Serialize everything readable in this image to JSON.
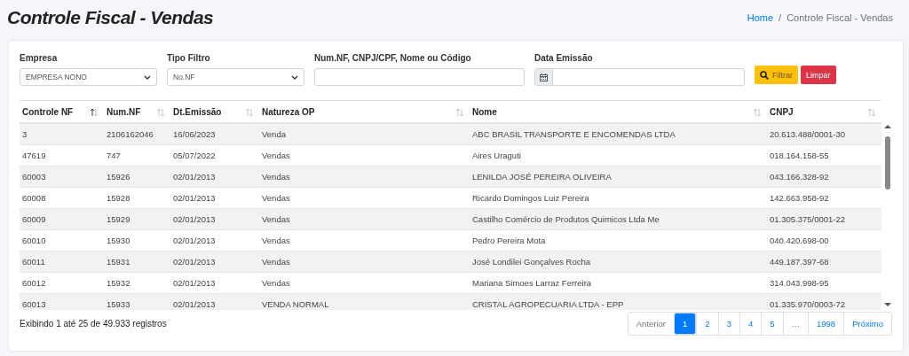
{
  "page_title": "Controle Fiscal - Vendas",
  "breadcrumb": [
    {
      "label": "Home",
      "link": true
    },
    {
      "label": "Controle Fiscal - Vendas",
      "link": false
    }
  ],
  "breadcrumb_separator": "/",
  "filters": [
    {
      "kind": "select",
      "label": "Empresa",
      "value": "EMPRESA NONO"
    },
    {
      "kind": "select",
      "label": "Tipo Filtro",
      "value": "No.NF"
    },
    {
      "kind": "text",
      "label": "Num.NF, CNPJ/CPF, Nome ou Código"
    },
    {
      "kind": "date",
      "label": "Data Emissão"
    }
  ],
  "buttons": [
    {
      "label": "Filtrar",
      "kind": "search"
    },
    {
      "label": "Limpar",
      "kind": "danger"
    }
  ],
  "table": {
    "columns": [
      {
        "label": "Controle NF",
        "sorted": true
      },
      {
        "label": "Num.NF",
        "sorted": false
      },
      {
        "label": "Dt.Emissão",
        "sorted": false
      },
      {
        "label": "Natureza OP",
        "sorted": false
      },
      {
        "label": "Nome",
        "sorted": false
      },
      {
        "label": "CNPJ",
        "sorted": false
      }
    ],
    "rows": [
      [
        "3",
        "2106162046",
        "16/06/2023",
        "Venda",
        "ABC BRASIL TRANSPORTE E ENCOMENDAS LTDA",
        "20.613.488/0001-30"
      ],
      [
        "47619",
        "747",
        "05/07/2022",
        "Vendas",
        "Aires Uraguti",
        "018.164.158-55"
      ],
      [
        "60003",
        "15926",
        "02/01/2013",
        "Vendas",
        "LENILDA JOSÉ PEREIRA OLIVEIRA",
        "043.166.328-92"
      ],
      [
        "60008",
        "15928",
        "02/01/2013",
        "Vendas",
        "Ricardo Domingos Luiz Pereira",
        "142.663.958-92"
      ],
      [
        "60009",
        "15929",
        "02/01/2013",
        "Vendas",
        "Castilho Comércio de Produtos Quimicos Ltda Me",
        "01.305.375/0001-22"
      ],
      [
        "60010",
        "15930",
        "02/01/2013",
        "Vendas",
        "Pedro Pereira Mota",
        "040.420.698-00"
      ],
      [
        "60011",
        "15931",
        "02/01/2013",
        "Vendas",
        "José Londilei Gonçalves Rocha",
        "449.187.397-68"
      ],
      [
        "60012",
        "15932",
        "02/01/2013",
        "Vendas",
        "Mariana Simoes Larraz Ferreira",
        "314.043.998-95"
      ],
      [
        "60013",
        "15933",
        "02/01/2013",
        "VENDA NORMAL",
        "CRISTAL AGROPECUARIA LTDA - EPP",
        "01.335.970/0003-72"
      ]
    ]
  },
  "info": "Exibindo 1 até 25 de 49.933 registros",
  "pagination": [
    {
      "label": "Anterior",
      "selected": false,
      "disabled": true
    },
    {
      "label": "1",
      "selected": true,
      "disabled": false
    },
    {
      "label": "2",
      "selected": false,
      "disabled": false
    },
    {
      "label": "3",
      "selected": false,
      "disabled": false
    },
    {
      "label": "4",
      "selected": false,
      "disabled": false
    },
    {
      "label": "5",
      "selected": false,
      "disabled": false
    },
    {
      "label": "…",
      "selected": false,
      "disabled": true
    },
    {
      "label": "1998",
      "selected": false,
      "disabled": false
    },
    {
      "label": "Próximo",
      "selected": false,
      "disabled": false
    }
  ]
}
